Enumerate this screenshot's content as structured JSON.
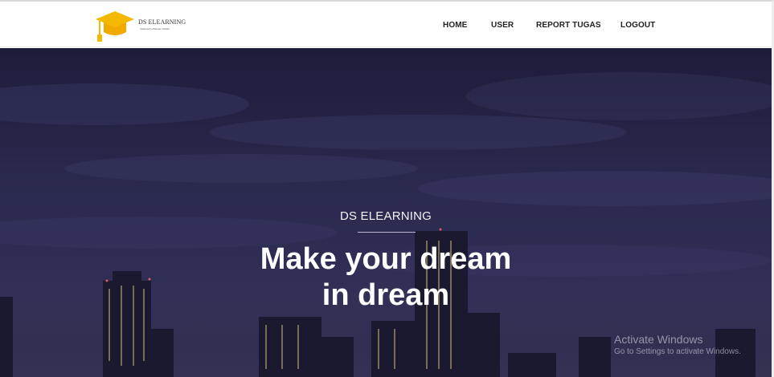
{
  "brand": {
    "name": "DS ELEARNING",
    "tagline": "Tempatnya Belajar Online",
    "icon": "graduation-cap-icon",
    "accent_color": "#f5b800"
  },
  "nav": {
    "items": [
      {
        "label": "HOME"
      },
      {
        "label": "USER"
      },
      {
        "label": "REPORT TUGAS"
      },
      {
        "label": "LOGOUT"
      }
    ]
  },
  "hero": {
    "kicker": "DS ELEARNING",
    "title_line1": "Make your dream",
    "title_line2": "in dream",
    "background": "night-city-skyline"
  },
  "overlay": {
    "activation_title": "Activate Windows",
    "activation_subtitle": "Go to Settings to activate Windows."
  }
}
